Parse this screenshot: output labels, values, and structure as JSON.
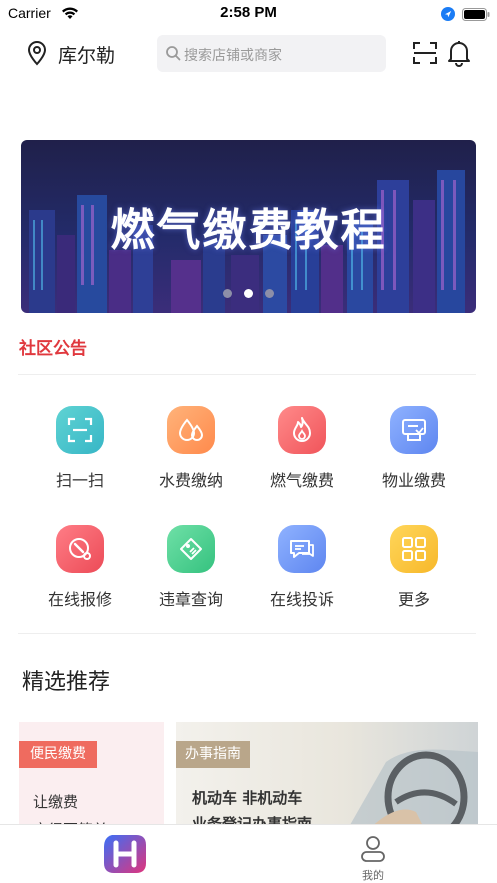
{
  "status_bar": {
    "carrier": "Carrier",
    "time": "2:58 PM"
  },
  "header": {
    "city": "库尔勒",
    "search_placeholder": "搜索店铺或商家",
    "icons": [
      "location-pin-icon",
      "search-icon",
      "scan-icon",
      "bell-icon"
    ]
  },
  "banner": {
    "title": "燃气缴费教程",
    "page_count": 3,
    "active_page": 2
  },
  "notice": {
    "title": "社区公告"
  },
  "services": [
    {
      "label": "扫一扫",
      "icon": "scan-icon",
      "color_from": "#5fd3d3",
      "color_to": "#37b6c6"
    },
    {
      "label": "水费缴纳",
      "icon": "water-drop-icon",
      "color_from": "#ffb37a",
      "color_to": "#ff8a4c"
    },
    {
      "label": "燃气缴费",
      "icon": "flame-icon",
      "color_from": "#ff8a8a",
      "color_to": "#f0545a"
    },
    {
      "label": "物业缴费",
      "icon": "property-icon",
      "color_from": "#8fb2ff",
      "color_to": "#5e86f0"
    },
    {
      "label": "在线报修",
      "icon": "wrench-icon",
      "color_from": "#ff7d86",
      "color_to": "#ec4b57"
    },
    {
      "label": "违章查询",
      "icon": "ticket-icon",
      "color_from": "#6fe0a7",
      "color_to": "#35c27f"
    },
    {
      "label": "在线投诉",
      "icon": "chat-icon",
      "color_from": "#8fb2ff",
      "color_to": "#5e86f0"
    },
    {
      "label": "更多",
      "icon": "grid-icon",
      "color_from": "#ffd65a",
      "color_to": "#f7b82a"
    }
  ],
  "recommend": {
    "title": "精选推荐",
    "cards": [
      {
        "tag": "便民缴费",
        "line1": "让缴费",
        "line2": "变得更简单"
      },
      {
        "tag": "办事指南",
        "line1": "机动车 非机动车",
        "line2": "业务登记办事指南"
      }
    ]
  },
  "tabbar": {
    "me_label": "我的"
  }
}
